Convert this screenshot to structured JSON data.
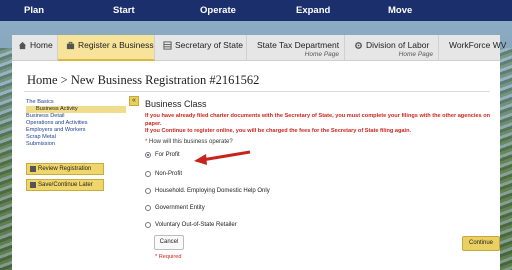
{
  "top_nav": [
    "Plan",
    "Start",
    "Operate",
    "Expand",
    "Move"
  ],
  "tabs": [
    {
      "label": "Home",
      "sub": "",
      "icon": "home-icon"
    },
    {
      "label": "Register a Business",
      "sub": "",
      "icon": "briefcase-icon"
    },
    {
      "label": "Secretary of State",
      "sub": "",
      "icon": "building-icon"
    },
    {
      "label": "State Tax Department",
      "sub": "Home Page",
      "icon": "document-icon"
    },
    {
      "label": "Division of Labor",
      "sub": "Home Page",
      "icon": "gear-icon"
    },
    {
      "label": "WorkForce WV",
      "sub": "",
      "icon": "grid-icon"
    }
  ],
  "page_title": "Home > New Business Registration #2161562",
  "sidebar": {
    "items": [
      {
        "label": "The Basics",
        "active": false
      },
      {
        "label": "Business Activity",
        "active": true
      },
      {
        "label": "Business Detail",
        "active": false
      },
      {
        "label": "Operations and Activities",
        "active": false
      },
      {
        "label": "Employers and Workers",
        "active": false
      },
      {
        "label": "Scrap Metal",
        "active": false
      },
      {
        "label": "Submission",
        "active": false
      }
    ],
    "review_label": "Review Registration",
    "save_label": "Save/Continue Later"
  },
  "collapse_glyph": "«",
  "form": {
    "heading": "Business Class",
    "warning_1": "If you have already filed charter documents with the Secretary of State, you must complete your filings with the other agencies on paper.",
    "warning_2": "If you Continue to register online, you will be charged the fees for the Secretary of State filing again.",
    "question": "How will this business operate?",
    "required_star": "*",
    "options": [
      {
        "label": "For Profit",
        "checked": true
      },
      {
        "label": "Non-Profit",
        "checked": false
      },
      {
        "label": "Household. Employing Domestic Help Only",
        "checked": false
      },
      {
        "label": "Government Entity",
        "checked": false
      },
      {
        "label": "Voluntary Out-of-State Retailer",
        "checked": false
      }
    ],
    "cancel_label": "Cancel",
    "required_note": "* Required",
    "continue_label": "Continue"
  },
  "colors": {
    "nav_bg": "#1b2f6c",
    "accent_gold": "#ead062",
    "warning_red": "#d1241b",
    "annotation_arrow": "#c8241b"
  }
}
